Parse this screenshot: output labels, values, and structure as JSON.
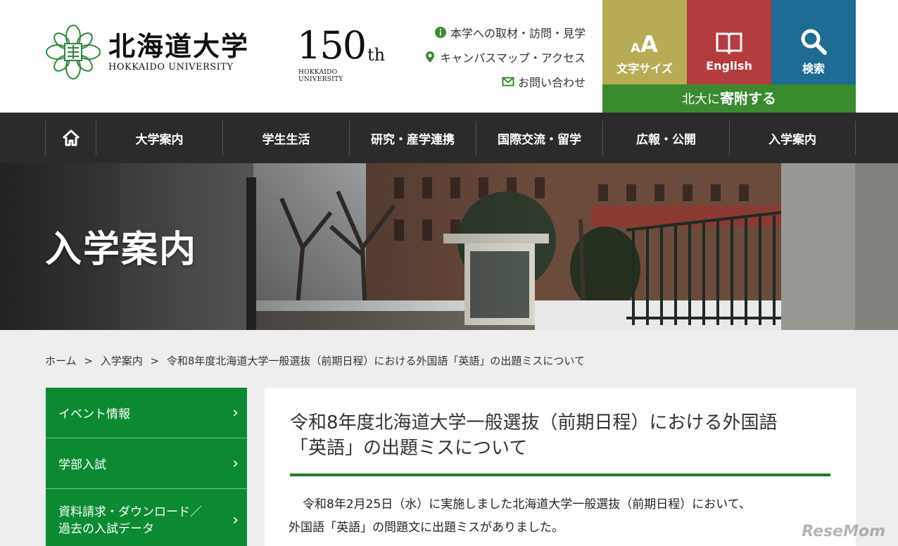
{
  "header": {
    "logo_ja": "北海道大学",
    "logo_en": "HOKKAIDO UNIVERSITY",
    "anniversary": {
      "num": "150",
      "suffix": "th",
      "sub": "HOKKAIDO UNIVERSITY"
    },
    "util_links": [
      {
        "label": "本学への取材・訪問・見学",
        "icon": "info-icon",
        "color": "#3a8a2e"
      },
      {
        "label": "キャンパスマップ・アクセス",
        "icon": "map-pin-icon",
        "color": "#3a8a2e"
      },
      {
        "label": "お問い合わせ",
        "icon": "mail-icon",
        "color": "#3a8a2e"
      }
    ],
    "tools": {
      "font_size_label": "文字サイズ",
      "english_label": "English",
      "search_label": "検索",
      "donate_prefix": "北大に",
      "donate_emph": "寄附する"
    }
  },
  "nav": {
    "home_icon": "home-icon",
    "items": [
      "大学案内",
      "学生生活",
      "研究・産学連携",
      "国際交流・留学",
      "広報・公開",
      "入学案内"
    ]
  },
  "hero": {
    "title": "入学案内"
  },
  "breadcrumb": {
    "items": [
      "ホーム",
      "入学案内",
      "令和8年度北海道大学一般選抜（前期日程）における外国語「英語」の出題ミスについて"
    ],
    "separator": ">"
  },
  "sidebar": {
    "items": [
      {
        "line1": "イベント情報",
        "line2": ""
      },
      {
        "line1": "学部入試",
        "line2": ""
      },
      {
        "line1": "資料請求・ダウンロード／",
        "line2": "過去の入試データ"
      }
    ]
  },
  "article": {
    "title_line1": "令和8年度北海道大学一般選抜（前期日程）における外国語",
    "title_line2": "「英語」の出題ミスについて",
    "body_line1": "令和8年2月25日（水）に実施しました北海道大学一般選抜（前期日程）において、",
    "body_line2": "外国語「英語」の問題文に出題ミスがありました。"
  },
  "watermark": "ReseMom",
  "colors": {
    "nav_bg": "#2b2b2b",
    "sidebar_green": "#0c8a32",
    "font_size_bg": "#b7ac55",
    "english_bg": "#b33c3f",
    "search_bg": "#1e6b93",
    "donate_bg": "#3a8a2e",
    "rule_green": "#1c7a2e"
  }
}
